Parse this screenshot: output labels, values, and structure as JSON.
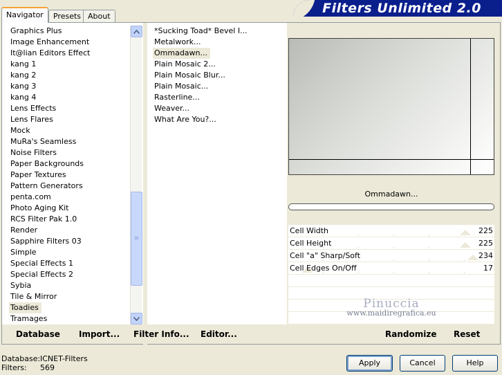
{
  "tabs": [
    {
      "label": "Navigator",
      "active": true
    },
    {
      "label": "Presets",
      "active": false
    },
    {
      "label": "About",
      "active": false
    }
  ],
  "banner_title": "Filters Unlimited 2.0",
  "categories": [
    "Graphics Plus",
    "Image Enhancement",
    "It@lian Editors Effect",
    "kang 1",
    "kang 2",
    "kang 3",
    "kang 4",
    "Lens Effects",
    "Lens Flares",
    "Mock",
    "MuRa's Seamless",
    "Noise Filters",
    "Paper Backgrounds",
    "Paper Textures",
    "Pattern Generators",
    "penta.com",
    "Photo Aging Kit",
    "RCS Filter Pak 1.0",
    "Render",
    "Sapphire Filters 03",
    "Simple",
    "Special Effects 1",
    "Special Effects 2",
    "Sybia",
    "Tile & Mirror",
    "Toadies",
    "Tramages"
  ],
  "selected_category": "Toadies",
  "filters": [
    "*Sucking Toad*  Bevel I...",
    "Metalwork...",
    "Ommadawn...",
    "Plain Mosaic 2...",
    "Plain Mosaic Blur...",
    "Plain Mosaic...",
    "Rasterline...",
    "Weaver...",
    "What Are You?..."
  ],
  "selected_filter": "Ommadawn...",
  "current_filter_name": "Ommadawn...",
  "params": [
    {
      "label": "Cell Width",
      "value": "225",
      "level": 0.88
    },
    {
      "label": "Cell Height",
      "value": "225",
      "level": 0.88
    },
    {
      "label": "Cell \"a\" Sharp/Soft",
      "value": "234",
      "level": 0.92
    },
    {
      "label": "Cell Edges On/Off",
      "value": "17",
      "level": 0.07
    }
  ],
  "watermark": {
    "name": "Pinuccia",
    "url": "www.maidiregrafica.eu"
  },
  "bottom_links": {
    "database": "Database",
    "import": "Import...",
    "filter_info": "Filter Info...",
    "editor": "Editor...",
    "randomize": "Randomize",
    "reset": "Reset"
  },
  "footer": {
    "database_label": "Database:",
    "database_value": "ICNET-Filters",
    "filters_label": "Filters:",
    "filters_value": "569"
  },
  "buttons": {
    "apply": "Apply",
    "cancel": "Cancel",
    "help": "Help"
  },
  "colors": {
    "banner": "#0a1f8c",
    "panel": "#ece9d8",
    "tab_accent": "#f7a234"
  }
}
